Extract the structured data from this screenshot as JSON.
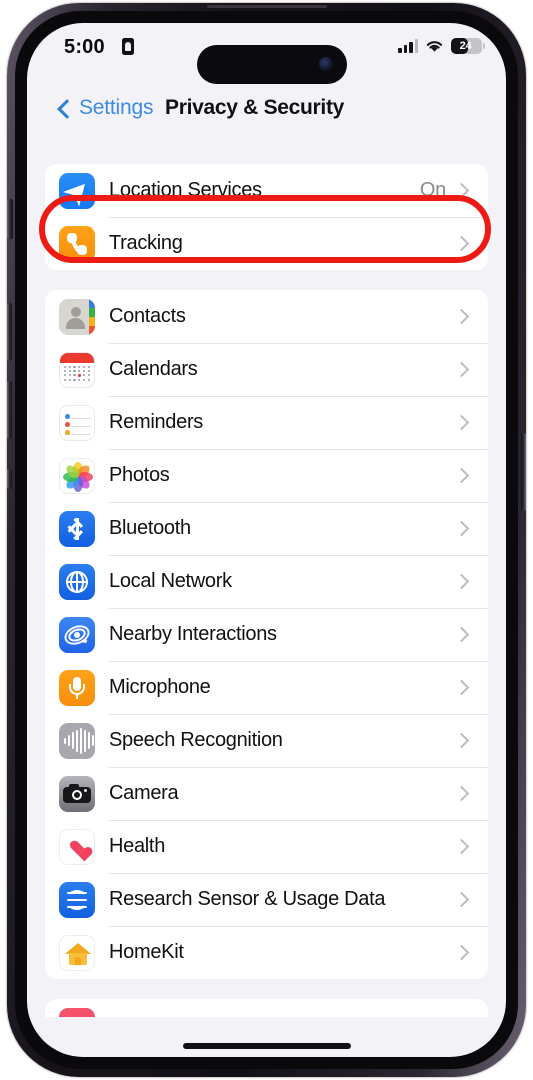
{
  "status_bar": {
    "time": "5:00",
    "lock_badge_icon": "privacy-recording-indicator-icon",
    "signal_icon": "cellular-signal-icon",
    "wifi_icon": "wifi-icon",
    "battery_level": "24",
    "battery_icon": "battery-icon"
  },
  "nav": {
    "back_label": "Settings",
    "back_icon": "chevron-left-icon",
    "title": "Privacy & Security"
  },
  "groups": [
    {
      "id": "group-primary",
      "rows": [
        {
          "label": "Location Services",
          "value": "On",
          "icon": "location-services-icon",
          "icon_class": "ic-location",
          "highlighted": true
        },
        {
          "label": "Tracking",
          "value": "",
          "icon": "tracking-icon",
          "icon_class": "ic-tracking",
          "highlighted": false
        }
      ]
    },
    {
      "id": "group-app-permissions",
      "rows": [
        {
          "label": "Contacts",
          "value": "",
          "icon": "contacts-icon",
          "icon_class": "ic-contacts"
        },
        {
          "label": "Calendars",
          "value": "",
          "icon": "calendars-icon",
          "icon_class": "ic-calendars"
        },
        {
          "label": "Reminders",
          "value": "",
          "icon": "reminders-icon",
          "icon_class": "ic-reminders"
        },
        {
          "label": "Photos",
          "value": "",
          "icon": "photos-icon",
          "icon_class": "ic-photos"
        },
        {
          "label": "Bluetooth",
          "value": "",
          "icon": "bluetooth-icon",
          "icon_class": "ic-bluetooth"
        },
        {
          "label": "Local Network",
          "value": "",
          "icon": "local-network-icon",
          "icon_class": "ic-localnetwork"
        },
        {
          "label": "Nearby Interactions",
          "value": "",
          "icon": "nearby-interactions-icon",
          "icon_class": "ic-nearby"
        },
        {
          "label": "Microphone",
          "value": "",
          "icon": "microphone-icon",
          "icon_class": "ic-microphone"
        },
        {
          "label": "Speech Recognition",
          "value": "",
          "icon": "speech-recognition-icon",
          "icon_class": "ic-speech"
        },
        {
          "label": "Camera",
          "value": "",
          "icon": "camera-icon",
          "icon_class": "ic-camera"
        },
        {
          "label": "Health",
          "value": "",
          "icon": "health-icon",
          "icon_class": "ic-health"
        },
        {
          "label": "Research Sensor & Usage Data",
          "value": "",
          "icon": "research-sensor-icon",
          "icon_class": "ic-research"
        },
        {
          "label": "HomeKit",
          "value": "",
          "icon": "homekit-icon",
          "icon_class": "ic-homekit"
        },
        {
          "label": "",
          "value": "",
          "icon": "media-and-apple-music-icon",
          "icon_class": "ic-media",
          "partial": true
        }
      ]
    }
  ],
  "annotation": {
    "highlight_color": "#ee1b15",
    "highlight_target": "Location Services"
  },
  "colors": {
    "screen_background": "#f2f2f7",
    "card_background": "#ffffff",
    "accent_blue": "#3d8be0",
    "secondary_text": "#8a8a8f",
    "primary_text": "#111114"
  },
  "device": {
    "home_indicator": "home-indicator",
    "dynamic_island": "dynamic-island"
  }
}
